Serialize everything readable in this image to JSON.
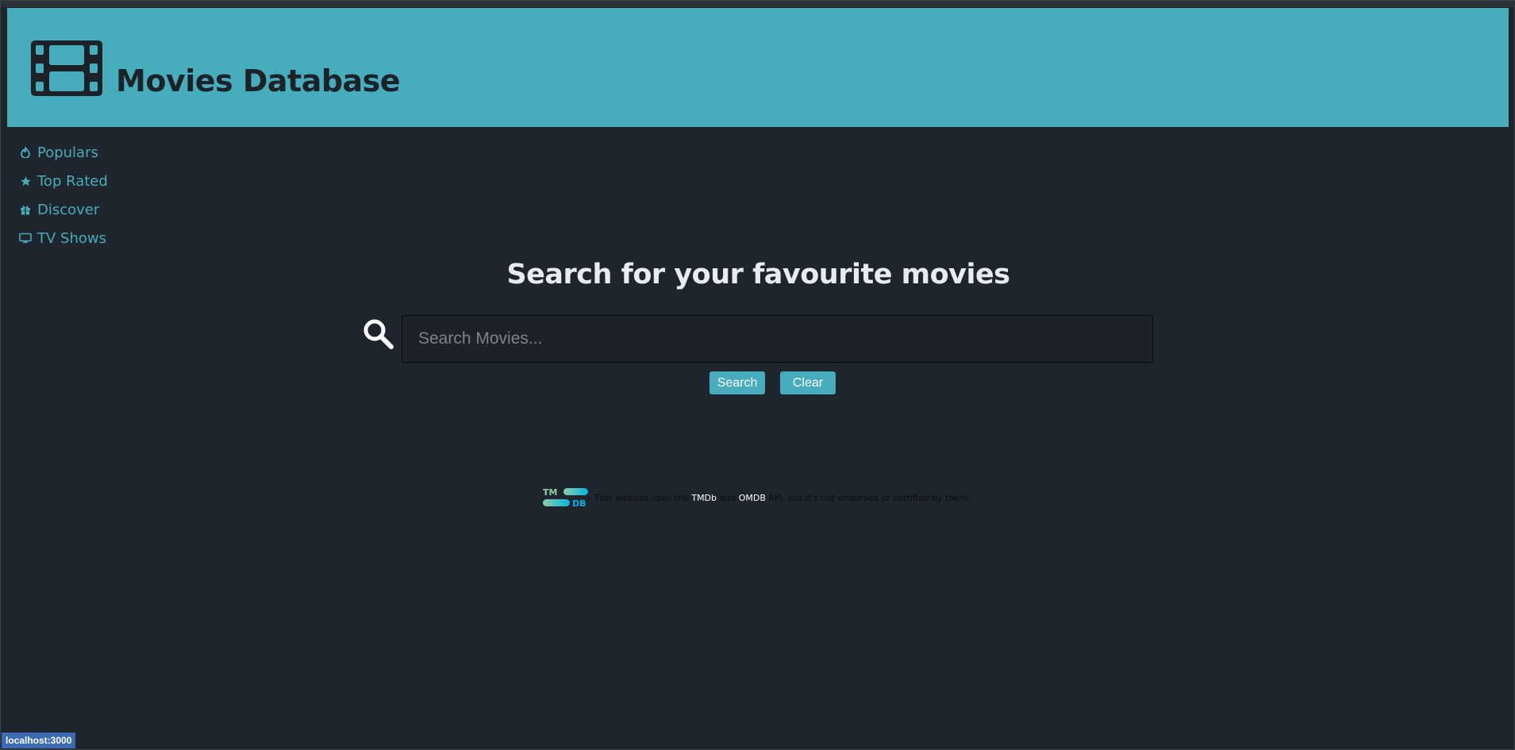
{
  "header": {
    "title": "Movies Database",
    "icon": "film-icon",
    "background": "#47acbb"
  },
  "sidebar": {
    "items": [
      {
        "label": "Populars",
        "icon": "fire-icon"
      },
      {
        "label": "Top Rated",
        "icon": "star-icon"
      },
      {
        "label": "Discover",
        "icon": "gift-icon"
      },
      {
        "label": "TV Shows",
        "icon": "tv-icon"
      }
    ]
  },
  "main": {
    "heading": "Search for your favourite movies",
    "search": {
      "placeholder": "Search Movies...",
      "value": ""
    },
    "search_button": "Search",
    "clear_button": "Clear"
  },
  "footer": {
    "logo_text_top": "TM",
    "logo_text_bottom": "DB",
    "text_before": "This website uses the",
    "link_tmdb": "TMDb",
    "text_and": "and",
    "link_omdb": "OMDB",
    "text_after": "API, but it's not endorsed or certified by them."
  },
  "status_bar": {
    "url": "localhost:3000"
  },
  "colors": {
    "accent": "#47acbb",
    "background": "#1f252c",
    "heading": "#e8ecef"
  }
}
